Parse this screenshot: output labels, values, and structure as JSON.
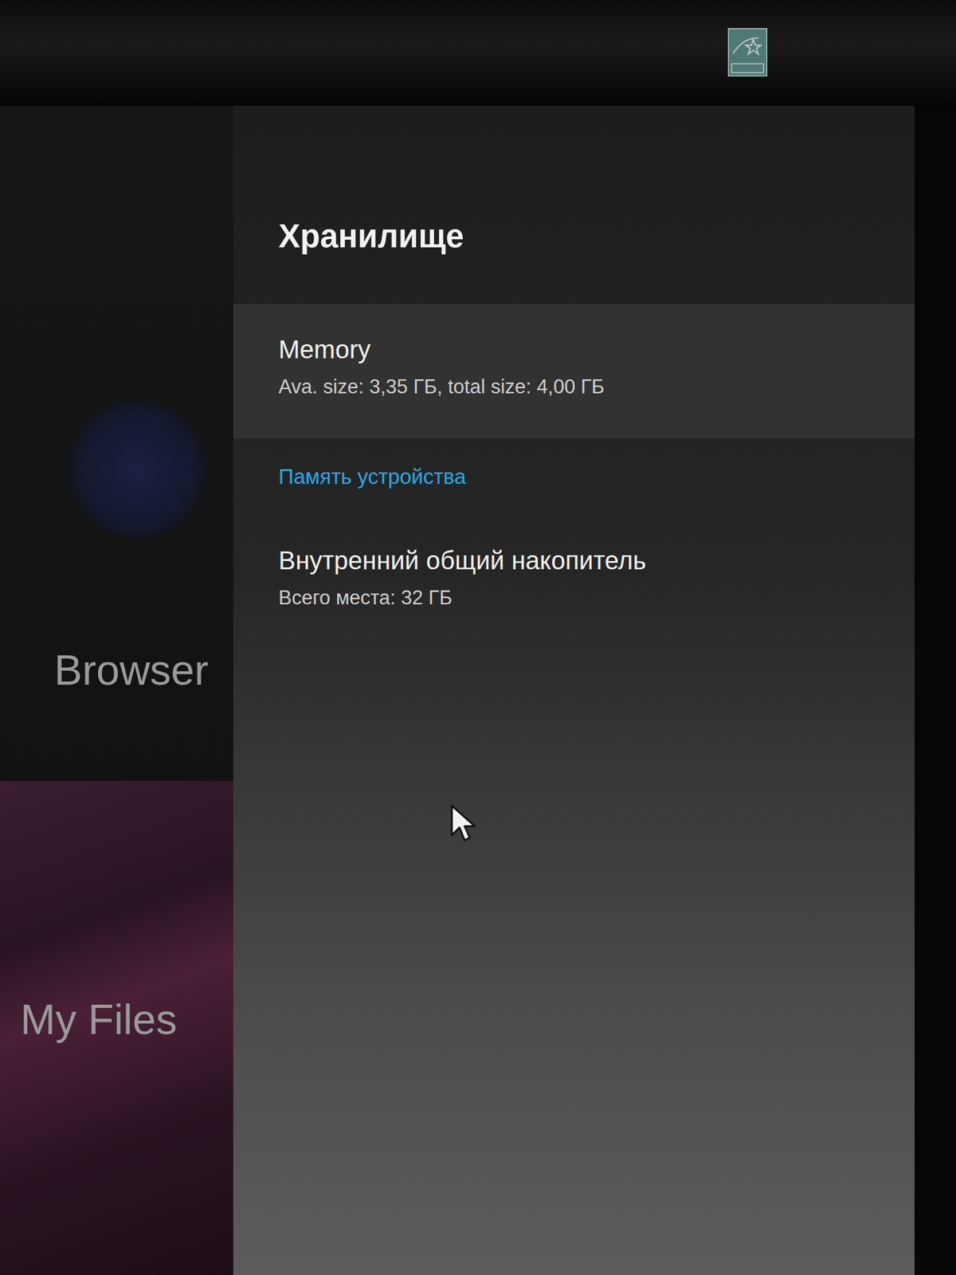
{
  "left_panel": {
    "items": [
      {
        "label": "Browser",
        "selected": false
      },
      {
        "label": "My Files",
        "selected": false
      }
    ]
  },
  "storage_panel": {
    "title": "Хранилище",
    "items": [
      {
        "kind": "item",
        "title": "Memory",
        "subtitle": "Ava. size: 3,35 ГБ, total size: 4,00 ГБ",
        "selected": true
      },
      {
        "kind": "header",
        "title": "Память устройства",
        "selected": false
      },
      {
        "kind": "item",
        "title": "Внутренний общий накопитель",
        "subtitle": "Всего места: 32 ГБ",
        "selected": false
      }
    ]
  }
}
